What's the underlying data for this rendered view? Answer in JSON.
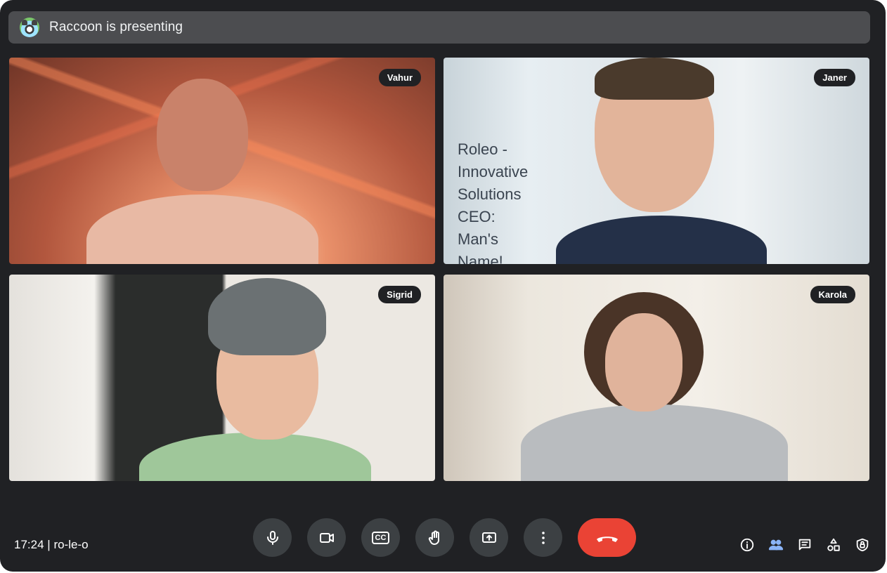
{
  "banner": {
    "presenting_text": "Raccoon is presenting"
  },
  "participants": [
    {
      "name": "Vahur"
    },
    {
      "name": "Janer",
      "background_sign": [
        "Roleo - Innovative Solutions",
        "CEO: Man's Name!"
      ]
    },
    {
      "name": "Sigrid"
    },
    {
      "name": "Karola"
    }
  ],
  "meeting": {
    "time": "17:24",
    "separator": "|",
    "code": "ro-le-o"
  },
  "controls": {
    "items": [
      {
        "icon": "microphone-icon"
      },
      {
        "icon": "camera-icon"
      },
      {
        "icon": "closed-captions-icon",
        "label": "CC"
      },
      {
        "icon": "raise-hand-icon"
      },
      {
        "icon": "present-screen-icon"
      },
      {
        "icon": "more-options-icon"
      },
      {
        "icon": "end-call-icon",
        "color": "#ea4335"
      }
    ]
  },
  "side_panel_icons": [
    "info-icon",
    "people-icon",
    "chat-icon",
    "activities-icon",
    "host-controls-icon"
  ],
  "colors": {
    "background": "#202124",
    "banner": "#4c4d50",
    "end_call": "#ea4335",
    "active_icon": "#8ab4f8"
  }
}
